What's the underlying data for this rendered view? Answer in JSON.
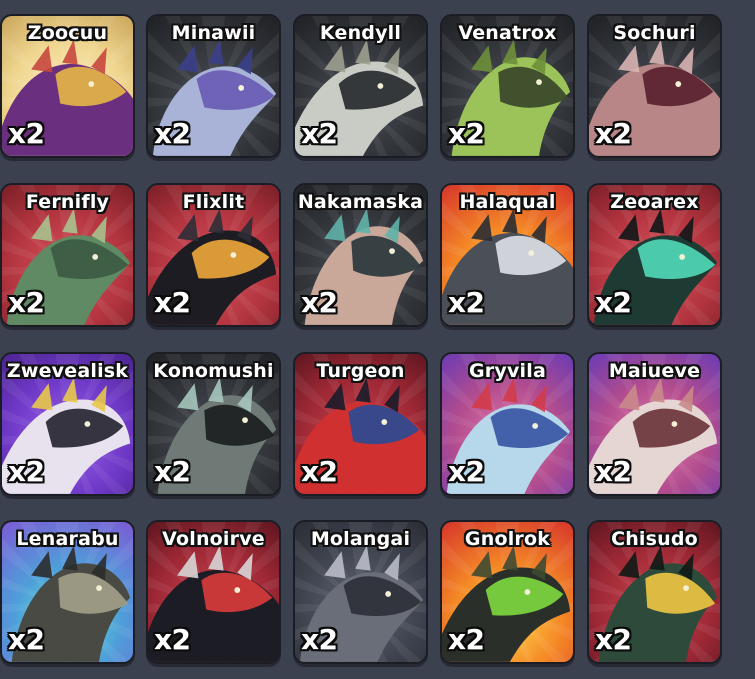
{
  "inventory": {
    "cards": [
      {
        "name": "Zoocuu",
        "count": "x2",
        "rarity": "gold",
        "colors": [
          "#6a2f7e",
          "#e0b04a",
          "#c8473d"
        ],
        "icon": "creature-zoocuu-icon"
      },
      {
        "name": "Minawii",
        "count": "x2",
        "rarity": "dark",
        "colors": [
          "#a9b3d8",
          "#6b5fb5",
          "#3b3f8a"
        ],
        "icon": "creature-minawii-icon"
      },
      {
        "name": "Kendyll",
        "count": "x2",
        "rarity": "dark",
        "colors": [
          "#c9ccc5",
          "#2c2f33",
          "#9ca08f"
        ],
        "icon": "creature-kendyll-icon"
      },
      {
        "name": "Venatrox",
        "count": "x2",
        "rarity": "dark",
        "colors": [
          "#9cc35a",
          "#3c4a2b",
          "#6d8f3a"
        ],
        "icon": "creature-venatrox-icon"
      },
      {
        "name": "Sochuri",
        "count": "x2",
        "rarity": "dark",
        "colors": [
          "#b88686",
          "#5b2430",
          "#d9b4b4"
        ],
        "icon": "creature-sochuri-icon"
      },
      {
        "name": "Fernifly",
        "count": "x2",
        "rarity": "red",
        "colors": [
          "#5f8a63",
          "#3c5c44",
          "#a7c28d"
        ],
        "icon": "creature-fernifly-icon"
      },
      {
        "name": "Flixlit",
        "count": "x2",
        "rarity": "red",
        "colors": [
          "#1c1c22",
          "#e6a13a",
          "#2d2d36"
        ],
        "icon": "creature-flixlit-icon"
      },
      {
        "name": "Nakamaska",
        "count": "x2",
        "rarity": "dark",
        "colors": [
          "#c9a89a",
          "#2f3b3f",
          "#5fb1a9"
        ],
        "icon": "creature-nakamaska-icon"
      },
      {
        "name": "Halaqual",
        "count": "x2",
        "rarity": "orange",
        "colors": [
          "#4b4f58",
          "#d7d9e0",
          "#2a2c33"
        ],
        "icon": "creature-halaqual-icon"
      },
      {
        "name": "Zeoarex",
        "count": "x2",
        "rarity": "red",
        "colors": [
          "#1e3b33",
          "#4fd3b3",
          "#111617"
        ],
        "icon": "creature-zeoarex-icon"
      },
      {
        "name": "Zwevealisk",
        "count": "x2",
        "rarity": "purple",
        "colors": [
          "#e8e2ef",
          "#2c2a36",
          "#e8c84a"
        ],
        "icon": "creature-zwevealisk-icon"
      },
      {
        "name": "Konomushi",
        "count": "x2",
        "rarity": "dark",
        "colors": [
          "#6f7a77",
          "#1d2222",
          "#a6c6bd"
        ],
        "icon": "creature-konomushi-icon"
      },
      {
        "name": "Turgeon",
        "count": "x2",
        "rarity": "crimson",
        "colors": [
          "#d0302f",
          "#2f4a8f",
          "#1b1c2a"
        ],
        "icon": "creature-turgeon-icon"
      },
      {
        "name": "Gryvila",
        "count": "x2",
        "rarity": "pink",
        "colors": [
          "#b7d8ea",
          "#3c5aa8",
          "#d23b4a"
        ],
        "icon": "creature-gryvila-icon"
      },
      {
        "name": "Maiueve",
        "count": "x2",
        "rarity": "pink",
        "colors": [
          "#e6d6d3",
          "#6f3a3f",
          "#c98a8a"
        ],
        "icon": "creature-maiueve-icon"
      },
      {
        "name": "Lenarabu",
        "count": "x2",
        "rarity": "teal",
        "colors": [
          "#4a4a44",
          "#9e9b86",
          "#2b2b2b"
        ],
        "icon": "creature-lenarabu-icon"
      },
      {
        "name": "Volnoirve",
        "count": "x2",
        "rarity": "crimson",
        "colors": [
          "#1c1c24",
          "#d33a3a",
          "#d6d6d6"
        ],
        "icon": "creature-volnoirve-icon"
      },
      {
        "name": "Molangai",
        "count": "x2",
        "rarity": "grey",
        "colors": [
          "#6a6e78",
          "#2f323a",
          "#b9bcc7"
        ],
        "icon": "creature-molangai-icon"
      },
      {
        "name": "Gnolrok",
        "count": "x2",
        "rarity": "orange",
        "colors": [
          "#2b2f2a",
          "#7ad13e",
          "#3e4a32"
        ],
        "icon": "creature-gnolrok-icon"
      },
      {
        "name": "Chisudo",
        "count": "x2",
        "rarity": "crimson",
        "colors": [
          "#2e4a3b",
          "#e7c041",
          "#0f1a16"
        ],
        "icon": "creature-chisudo-icon"
      }
    ]
  }
}
